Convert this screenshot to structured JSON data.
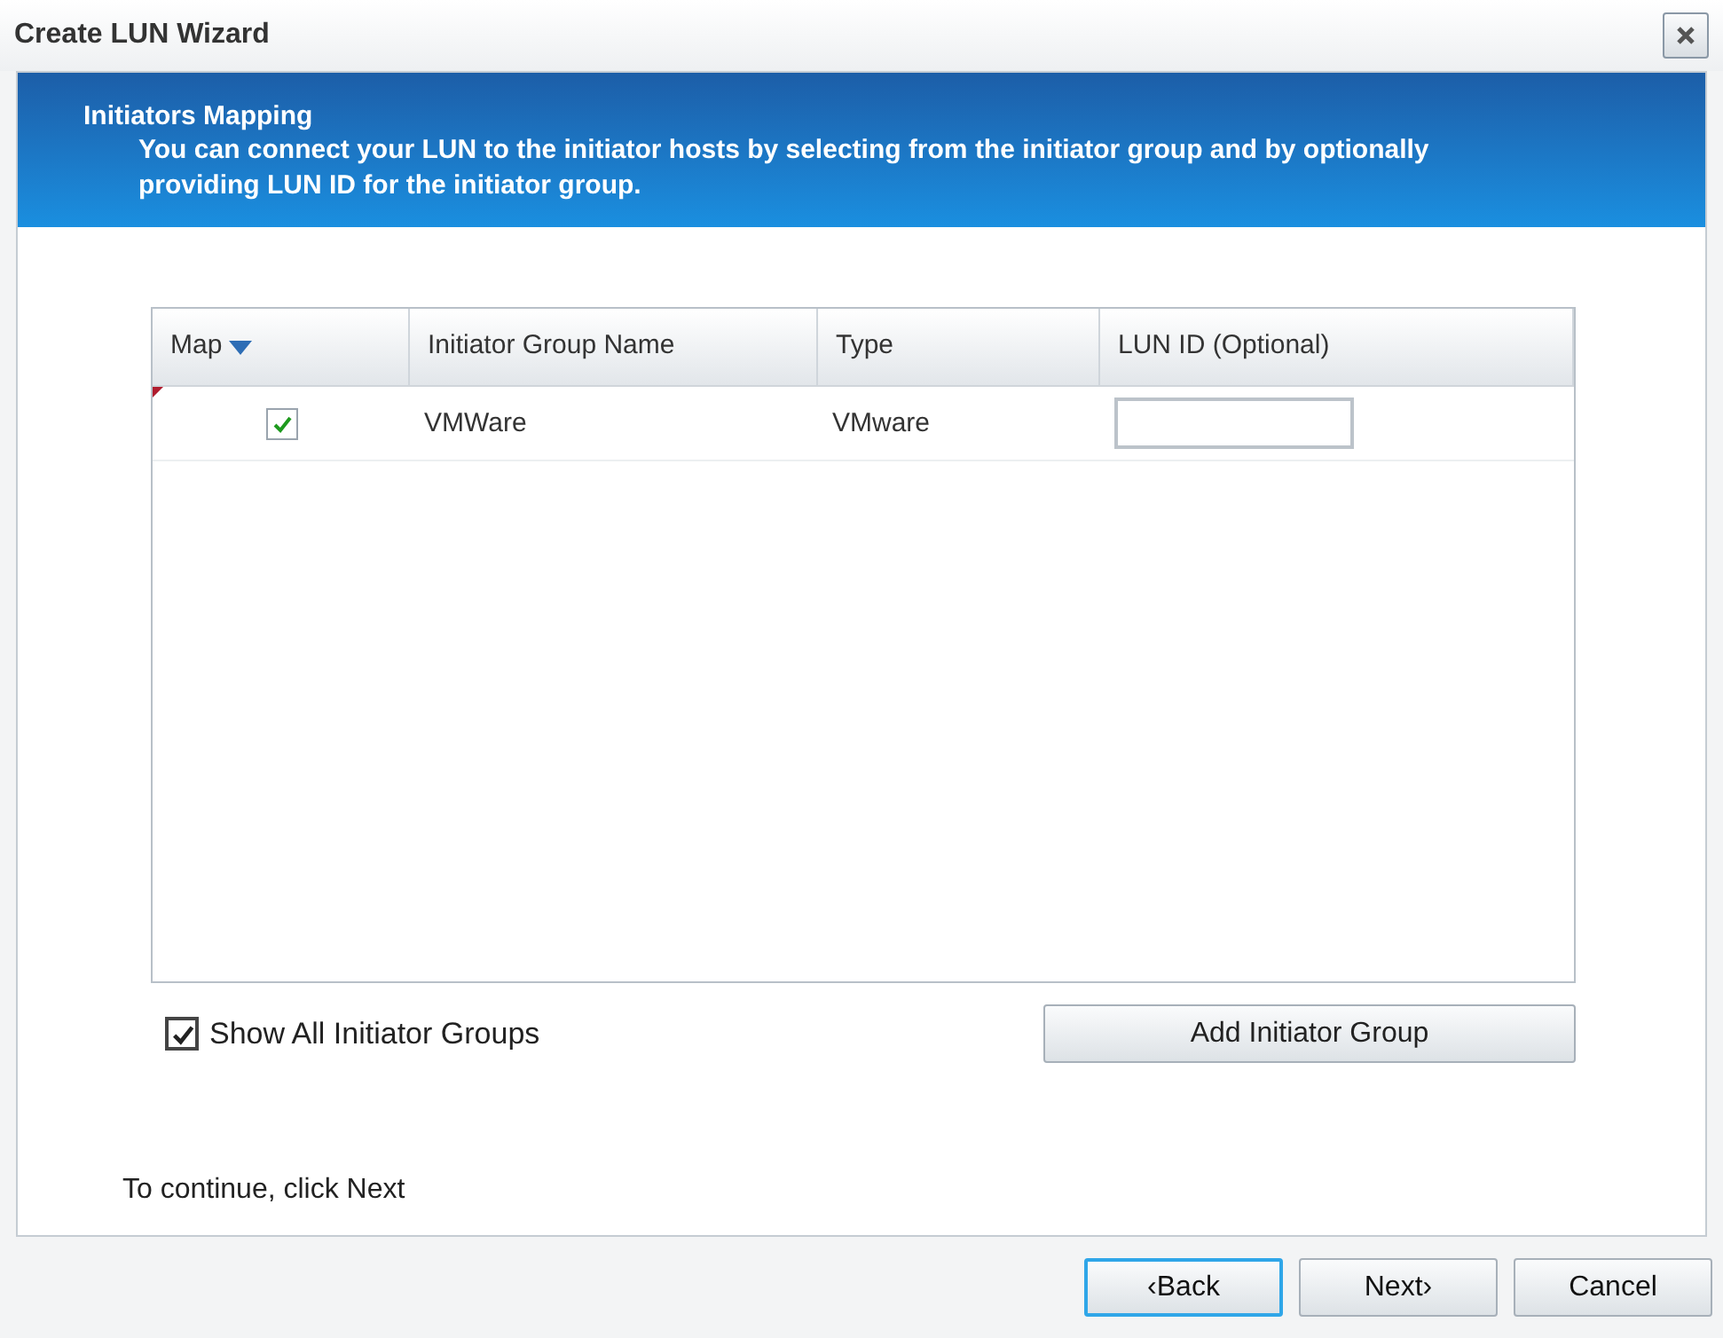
{
  "window": {
    "title": "Create LUN Wizard"
  },
  "header": {
    "title": "Initiators Mapping",
    "description": "You can connect your LUN to the initiator hosts by selecting from the initiator group and by optionally providing LUN ID for the initiator group."
  },
  "table": {
    "columns": [
      {
        "label": "Map",
        "sorted": true
      },
      {
        "label": "Initiator Group Name",
        "sorted": false
      },
      {
        "label": "Type",
        "sorted": false
      },
      {
        "label": "LUN ID (Optional)",
        "sorted": false
      }
    ],
    "rows": [
      {
        "map": true,
        "name": "VMWare",
        "type": "VMware",
        "lun_id": ""
      }
    ]
  },
  "show_all": {
    "label": "Show All Initiator Groups",
    "checked": true
  },
  "add_button": "Add Initiator Group",
  "hint": "To continue, click Next",
  "buttons": [
    {
      "label": "‹Back",
      "focused": true
    },
    {
      "label": "Next›",
      "focused": false
    },
    {
      "label": "Cancel",
      "focused": false
    }
  ]
}
